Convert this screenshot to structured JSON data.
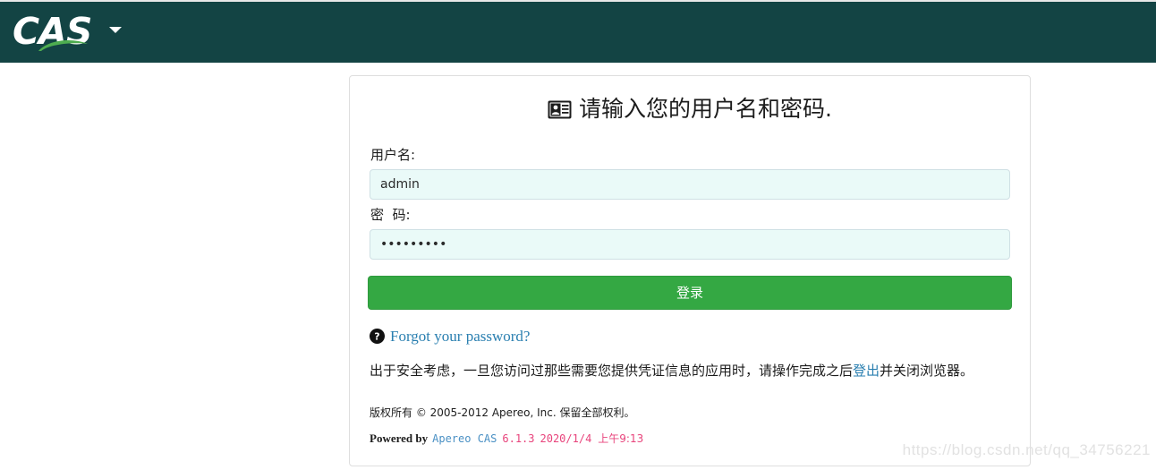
{
  "header": {
    "logo_text": "CAS",
    "logo_icon": "cas-swoosh-logo",
    "dropdown_icon": "chevron-down-icon",
    "background_color": "#134444"
  },
  "card": {
    "heading_icon": "id-card-icon",
    "heading": "请输入您的用户名和密码.",
    "username": {
      "label": "用户名:",
      "value": "admin",
      "placeholder": ""
    },
    "password": {
      "label": "密  码:",
      "value": "•••••••••",
      "placeholder": ""
    },
    "submit_label": "登录",
    "submit_color": "#34a843",
    "forgot": {
      "icon": "question-circle-icon",
      "label": "Forgot your password?",
      "link_color": "#2a7fb0"
    },
    "notice": {
      "before": "出于安全考虑，一旦您访问过那些需要您提供凭证信息的应用时，请操作完成之后",
      "link": "登出",
      "after": "并关闭浏览器。"
    },
    "footer": {
      "copyright": "版权所有 © 2005-2012 Apereo, Inc. 保留全部权利。",
      "powered_by": "Powered by",
      "product_link": "Apereo CAS",
      "version": "6.1.3",
      "build_date": "2020/1/4",
      "build_time": "上午9:13",
      "version_color": "#e8447c"
    }
  },
  "watermark": "https://blog.csdn.net/qq_34756221"
}
